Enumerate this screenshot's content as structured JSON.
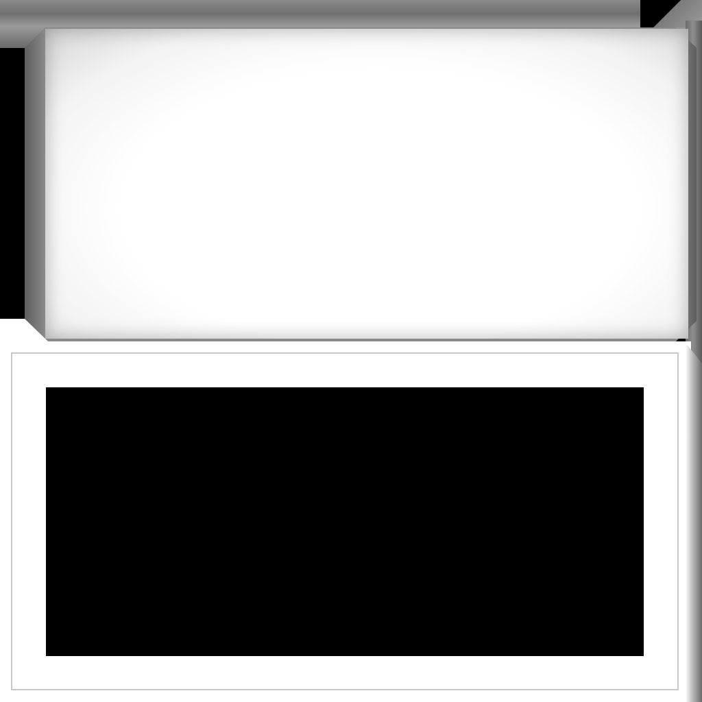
{
  "texture": {
    "colors": {
      "background": "#000000",
      "panel_white": "#ffffff",
      "bevel_grey": "#8a8a8a",
      "frame_border": "#c8c8c8",
      "screen_black": "#000000"
    }
  }
}
